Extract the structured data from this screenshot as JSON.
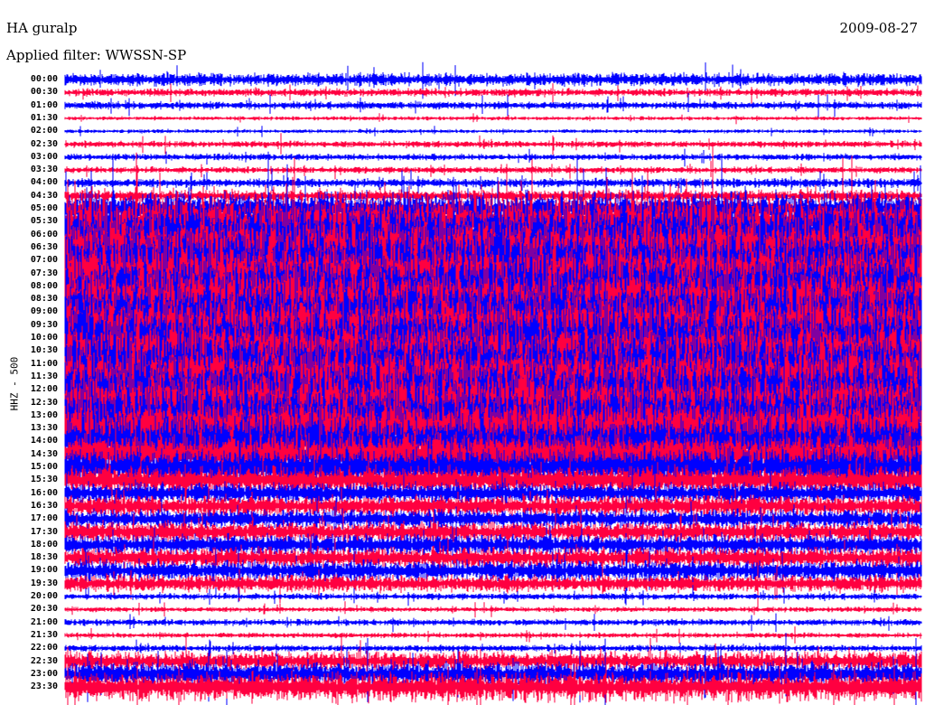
{
  "header": {
    "station": "HA guralp",
    "date": "2009-08-27",
    "filter": "Applied filter: WWSSN-SP"
  },
  "chart_data": {
    "type": "line",
    "title": "HA guralp",
    "ylabel": "HHZ - 500",
    "colors": [
      "#0000ff",
      "#ff0040"
    ],
    "row_labels": [
      "00:00",
      "00:30",
      "01:00",
      "01:30",
      "02:00",
      "02:30",
      "03:00",
      "03:30",
      "04:00",
      "04:30",
      "05:00",
      "05:30",
      "06:00",
      "06:30",
      "07:00",
      "07:30",
      "08:00",
      "08:30",
      "09:00",
      "09:30",
      "10:00",
      "10:30",
      "11:00",
      "11:30",
      "12:00",
      "12:30",
      "13:00",
      "13:30",
      "14:00",
      "14:30",
      "15:00",
      "15:30",
      "16:00",
      "16:30",
      "17:00",
      "17:30",
      "18:00",
      "18:30",
      "19:00",
      "19:30",
      "20:00",
      "20:30",
      "21:00",
      "21:30",
      "22:00",
      "22:30",
      "23:00",
      "23:30"
    ],
    "relative_amplitude": [
      1.0,
      0.6,
      0.6,
      0.3,
      0.3,
      0.5,
      0.5,
      0.5,
      0.7,
      0.9,
      2.5,
      4,
      5,
      5,
      5,
      5,
      5,
      5,
      5,
      5,
      5,
      5,
      5,
      5,
      5,
      5,
      5,
      5,
      4,
      3.5,
      3,
      2.2,
      1.6,
      1.6,
      1.5,
      1.6,
      1.6,
      1.6,
      1.6,
      1.3,
      0.5,
      0.4,
      0.5,
      0.4,
      0.5,
      1.5,
      2,
      2.2
    ]
  }
}
